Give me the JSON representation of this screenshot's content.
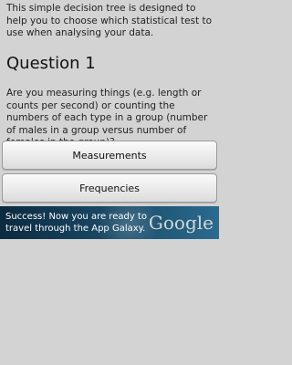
{
  "intro": "This simple decision tree is designed to help you to choose which statistical test to use when analysing your data.",
  "question": {
    "title": "Question 1",
    "text": "Are you measuring things (e.g. length or counts per second) or counting the numbers of each type in a group (number of males in a group versus number of females in the group)?"
  },
  "buttons": {
    "measurements": "Measurements",
    "frequencies": "Frequencies"
  },
  "ad": {
    "text": "Success! Now you are ready to travel through the App Galaxy.",
    "logo": "Google"
  }
}
